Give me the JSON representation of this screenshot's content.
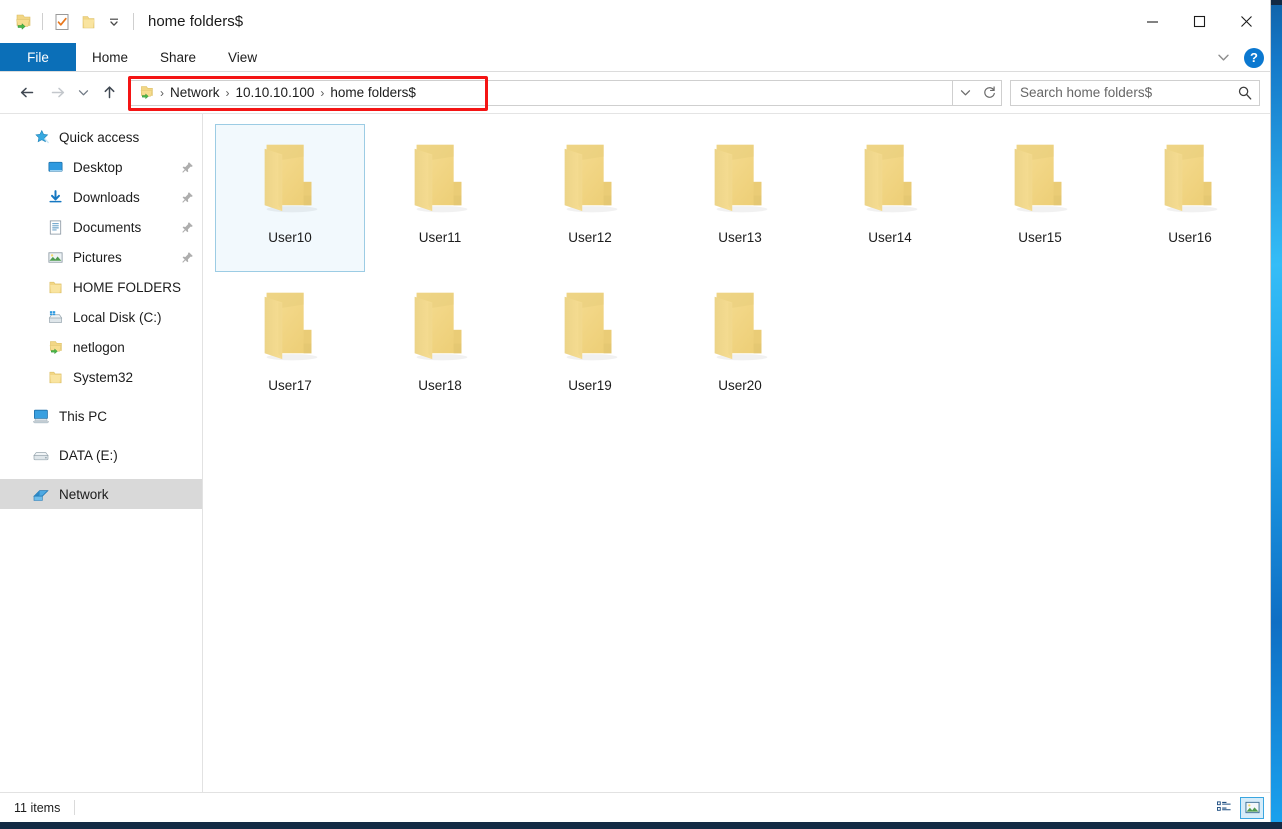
{
  "window": {
    "title": "home folders$",
    "quick_access_icons": [
      "network-folder-icon",
      "properties-checkbox-icon",
      "new-folder-icon",
      "customize-chevron-icon"
    ],
    "controls": {
      "minimize": "—",
      "maximize": "☐",
      "close": "✕"
    }
  },
  "ribbon": {
    "tabs": [
      {
        "label": "File",
        "active": true
      },
      {
        "label": "Home",
        "active": false
      },
      {
        "label": "Share",
        "active": false
      },
      {
        "label": "View",
        "active": false
      }
    ],
    "collapse_icon": "chevron-down-icon",
    "help_label": "?"
  },
  "navigation": {
    "back": "back-arrow-icon",
    "forward": "forward-arrow-icon",
    "recent": "recent-locations-chevron-icon",
    "up": "up-arrow-icon"
  },
  "address_bar": {
    "icon": "network-folder-icon",
    "crumbs": [
      "Network",
      "10.10.10.100",
      "home folders$"
    ],
    "separator": "›",
    "dropdown_icon": "chevron-down-icon",
    "refresh_icon": "refresh-icon",
    "highlight_color": "#f41414"
  },
  "search": {
    "placeholder": "Search home folders$",
    "value": "",
    "icon": "search-icon"
  },
  "sidebar": {
    "items": [
      {
        "label": "Quick access",
        "icon": "star-pin-icon",
        "level": 0,
        "pinned": false,
        "selected": false
      },
      {
        "label": "Desktop",
        "icon": "desktop-icon",
        "level": 1,
        "pinned": true,
        "selected": false
      },
      {
        "label": "Downloads",
        "icon": "downloads-icon",
        "level": 1,
        "pinned": true,
        "selected": false
      },
      {
        "label": "Documents",
        "icon": "documents-icon",
        "level": 1,
        "pinned": true,
        "selected": false
      },
      {
        "label": "Pictures",
        "icon": "pictures-icon",
        "level": 1,
        "pinned": true,
        "selected": false
      },
      {
        "label": "HOME FOLDERS",
        "icon": "folder-icon",
        "level": 1,
        "pinned": false,
        "selected": false
      },
      {
        "label": "Local Disk (C:)",
        "icon": "local-disk-icon",
        "level": 1,
        "pinned": false,
        "selected": false
      },
      {
        "label": "netlogon",
        "icon": "network-folder-icon",
        "level": 1,
        "pinned": false,
        "selected": false
      },
      {
        "label": "System32",
        "icon": "folder-icon",
        "level": 1,
        "pinned": false,
        "selected": false
      },
      {
        "label": "This PC",
        "icon": "this-pc-icon",
        "level": 0,
        "pinned": false,
        "selected": false,
        "gap_before": true
      },
      {
        "label": "DATA (E:)",
        "icon": "drive-icon",
        "level": 0,
        "pinned": false,
        "selected": false,
        "gap_before": true
      },
      {
        "label": "Network",
        "icon": "network-icon",
        "level": 0,
        "pinned": false,
        "selected": true,
        "gap_before": true
      }
    ]
  },
  "content": {
    "items": [
      {
        "name": "User10",
        "icon": "folder-icon",
        "selected": true
      },
      {
        "name": "User11",
        "icon": "folder-icon",
        "selected": false
      },
      {
        "name": "User12",
        "icon": "folder-icon",
        "selected": false
      },
      {
        "name": "User13",
        "icon": "folder-icon",
        "selected": false
      },
      {
        "name": "User14",
        "icon": "folder-icon",
        "selected": false
      },
      {
        "name": "User15",
        "icon": "folder-icon",
        "selected": false
      },
      {
        "name": "User16",
        "icon": "folder-icon",
        "selected": false
      },
      {
        "name": "User17",
        "icon": "folder-icon",
        "selected": false
      },
      {
        "name": "User18",
        "icon": "folder-icon",
        "selected": false
      },
      {
        "name": "User19",
        "icon": "folder-icon",
        "selected": false
      },
      {
        "name": "User20",
        "icon": "folder-icon",
        "selected": false
      }
    ]
  },
  "status_bar": {
    "item_count": "11 items",
    "views": [
      {
        "name": "details-view",
        "icon": "details-list-icon",
        "active": false
      },
      {
        "name": "large-icons-view",
        "icon": "large-icons-icon",
        "active": true
      }
    ]
  },
  "colors": {
    "folder_light": "#f7dd8f",
    "folder_mid": "#f2d685",
    "folder_dark": "#e6c96f",
    "accent_blue": "#0b6fb8",
    "selection": "#cce8f7",
    "highlight_red": "#f41414"
  }
}
